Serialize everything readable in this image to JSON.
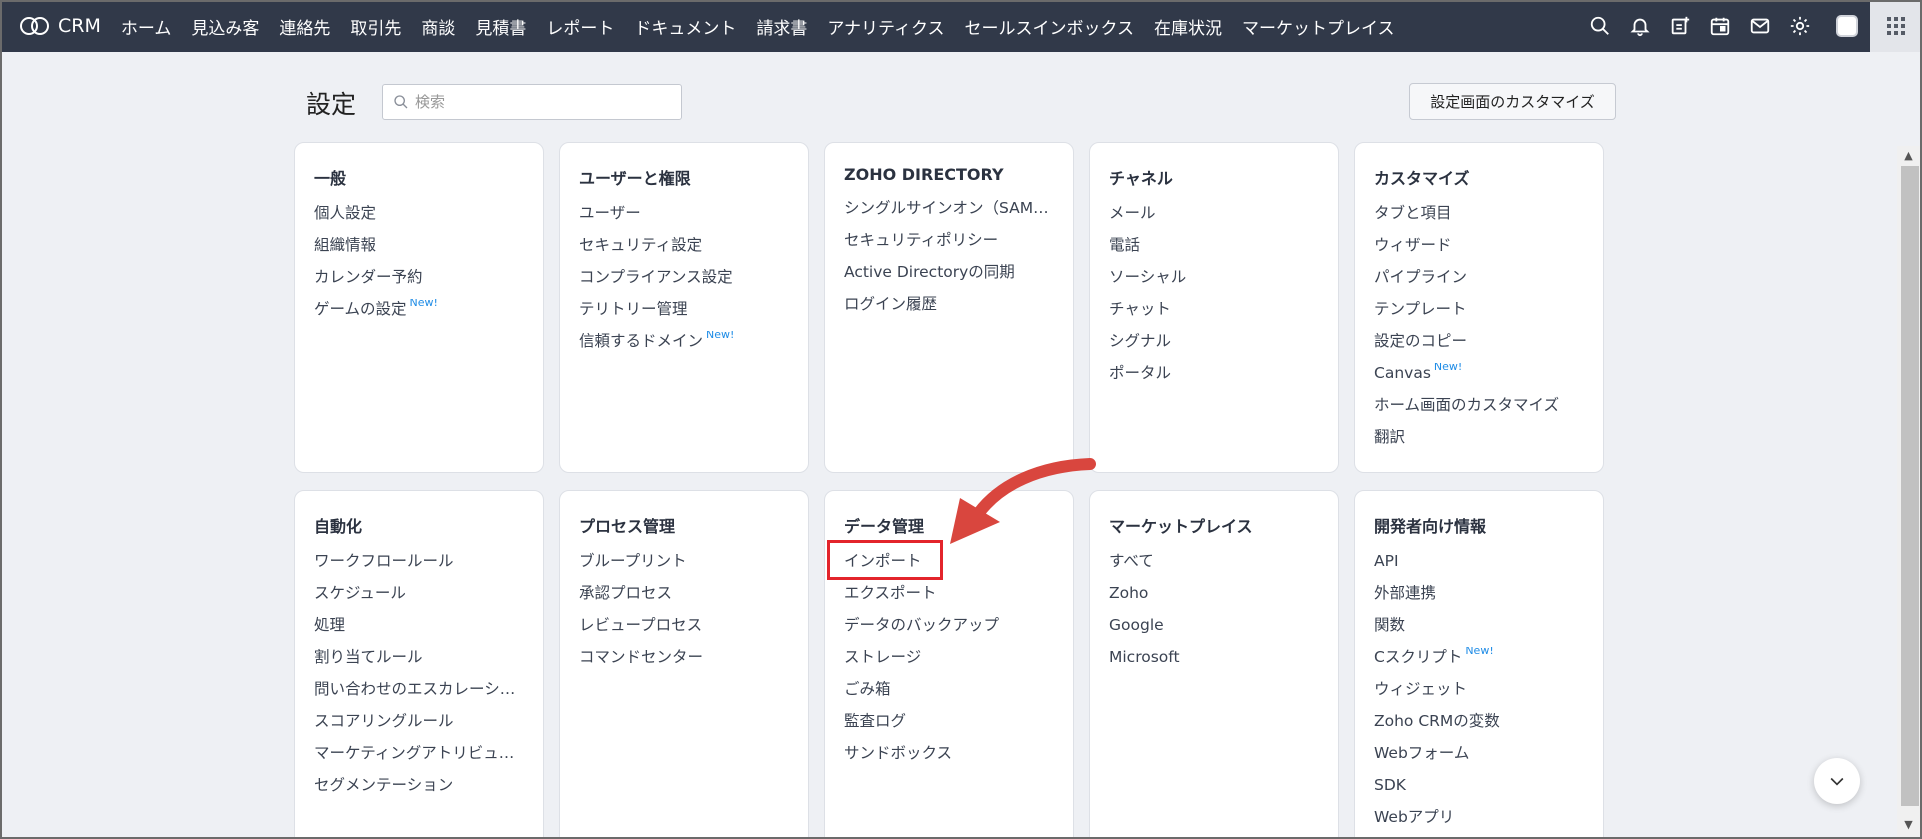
{
  "brand": {
    "name": "CRM"
  },
  "nav": {
    "items": [
      "ホーム",
      "見込み客",
      "連絡先",
      "取引先",
      "商談",
      "見積書",
      "レポート",
      "ドキュメント",
      "請求書",
      "アナリティクス",
      "セールスインボックス",
      "在庫状況",
      "マーケットプレイス"
    ],
    "icons": [
      "search-icon",
      "bell-icon",
      "add-note-icon",
      "calendar-icon",
      "mail-icon",
      "gear-icon"
    ]
  },
  "header": {
    "title": "設定",
    "search_placeholder": "検索",
    "customize_label": "設定画面のカスタマイズ"
  },
  "cards": [
    {
      "title": "一般",
      "links": [
        {
          "label": "個人設定"
        },
        {
          "label": "組織情報"
        },
        {
          "label": "カレンダー予約"
        },
        {
          "label": "ゲームの設定",
          "badge": "New!"
        }
      ]
    },
    {
      "title": "ユーザーと権限",
      "links": [
        {
          "label": "ユーザー"
        },
        {
          "label": "セキュリティ設定"
        },
        {
          "label": "コンプライアンス設定"
        },
        {
          "label": "テリトリー管理"
        },
        {
          "label": "信頼するドメイン",
          "badge": "New!"
        }
      ]
    },
    {
      "title": "ZOHO DIRECTORY",
      "links": [
        {
          "label": "シングルサインオン（SAML）"
        },
        {
          "label": "セキュリティポリシー"
        },
        {
          "label": "Active Directoryの同期"
        },
        {
          "label": "ログイン履歴"
        }
      ]
    },
    {
      "title": "チャネル",
      "links": [
        {
          "label": "メール"
        },
        {
          "label": "電話"
        },
        {
          "label": "ソーシャル"
        },
        {
          "label": "チャット"
        },
        {
          "label": "シグナル"
        },
        {
          "label": "ポータル"
        }
      ]
    },
    {
      "title": "カスタマイズ",
      "links": [
        {
          "label": "タブと項目"
        },
        {
          "label": "ウィザード"
        },
        {
          "label": "パイプライン"
        },
        {
          "label": "テンプレート"
        },
        {
          "label": "設定のコピー"
        },
        {
          "label": "Canvas",
          "badge": "New!"
        },
        {
          "label": "ホーム画面のカスタマイズ"
        },
        {
          "label": "翻訳"
        }
      ]
    },
    {
      "title": "自動化",
      "links": [
        {
          "label": "ワークフロールール"
        },
        {
          "label": "スケジュール"
        },
        {
          "label": "処理"
        },
        {
          "label": "割り当てルール"
        },
        {
          "label": "問い合わせのエスカレーショ..."
        },
        {
          "label": "スコアリングルール"
        },
        {
          "label": "マーケティングアトリビュー..."
        },
        {
          "label": "セグメンテーション"
        }
      ]
    },
    {
      "title": "プロセス管理",
      "links": [
        {
          "label": "ブループリント"
        },
        {
          "label": "承認プロセス"
        },
        {
          "label": "レビュープロセス"
        },
        {
          "label": "コマンドセンター"
        }
      ]
    },
    {
      "title": "データ管理",
      "links": [
        {
          "label": "インポート"
        },
        {
          "label": "エクスポート"
        },
        {
          "label": "データのバックアップ"
        },
        {
          "label": "ストレージ"
        },
        {
          "label": "ごみ箱"
        },
        {
          "label": "監査ログ"
        },
        {
          "label": "サンドボックス"
        }
      ]
    },
    {
      "title": "マーケットプレイス",
      "links": [
        {
          "label": "すべて"
        },
        {
          "label": "Zoho"
        },
        {
          "label": "Google"
        },
        {
          "label": "Microsoft"
        }
      ]
    },
    {
      "title": "開発者向け情報",
      "links": [
        {
          "label": "API"
        },
        {
          "label": "外部連携"
        },
        {
          "label": "関数"
        },
        {
          "label": "Cスクリプト",
          "badge": "New!"
        },
        {
          "label": "ウィジェット"
        },
        {
          "label": "Zoho CRMの変数"
        },
        {
          "label": "Webフォーム"
        },
        {
          "label": "SDK"
        },
        {
          "label": "Webアプリ"
        }
      ]
    }
  ],
  "colors": {
    "nav_bg": "#313949",
    "highlight": "#e3242b",
    "new_badge": "#1f8ce6"
  }
}
